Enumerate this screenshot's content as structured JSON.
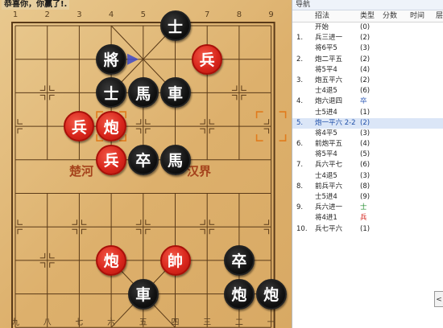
{
  "status_text": "恭喜你，你赢了!.",
  "board": {
    "top_files": [
      "1",
      "2",
      "3",
      "4",
      "5",
      "6",
      "7",
      "8",
      "9"
    ],
    "bottom_files": [
      "九",
      "八",
      "七",
      "六",
      "五",
      "四",
      "三",
      "二",
      "一"
    ],
    "river_left": "楚河",
    "river_right": "汉界",
    "pieces": [
      {
        "name": "black-advisor-top",
        "char": "士",
        "side": "black",
        "file": 5,
        "rank": 0
      },
      {
        "name": "black-general",
        "char": "將",
        "side": "black",
        "file": 3,
        "rank": 1
      },
      {
        "name": "red-soldier-upper-right",
        "char": "兵",
        "side": "red",
        "file": 6,
        "rank": 1
      },
      {
        "name": "black-advisor-mid",
        "char": "士",
        "side": "black",
        "file": 3,
        "rank": 2
      },
      {
        "name": "black-horse-top",
        "char": "馬",
        "side": "black",
        "file": 4,
        "rank": 2
      },
      {
        "name": "black-chariot-top",
        "char": "車",
        "side": "black",
        "file": 5,
        "rank": 2
      },
      {
        "name": "red-soldier-left",
        "char": "兵",
        "side": "red",
        "file": 2,
        "rank": 3
      },
      {
        "name": "red-cannon-top",
        "char": "炮",
        "side": "red",
        "file": 3,
        "rank": 3
      },
      {
        "name": "red-soldier-mid",
        "char": "兵",
        "side": "red",
        "file": 3,
        "rank": 4
      },
      {
        "name": "black-soldier-mid",
        "char": "卒",
        "side": "black",
        "file": 4,
        "rank": 4
      },
      {
        "name": "black-horse-mid",
        "char": "馬",
        "side": "black",
        "file": 5,
        "rank": 4
      },
      {
        "name": "red-cannon-bottom",
        "char": "炮",
        "side": "red",
        "file": 3,
        "rank": 7
      },
      {
        "name": "red-general",
        "char": "帥",
        "side": "red",
        "file": 5,
        "rank": 7
      },
      {
        "name": "black-soldier-bottom",
        "char": "卒",
        "side": "black",
        "file": 7,
        "rank": 7
      },
      {
        "name": "black-chariot-bottom",
        "char": "車",
        "side": "black",
        "file": 4,
        "rank": 8
      },
      {
        "name": "black-cannon-left",
        "char": "炮",
        "side": "black",
        "file": 7,
        "rank": 8
      },
      {
        "name": "black-cannon-right",
        "char": "炮",
        "side": "black",
        "file": 8,
        "rank": 8
      }
    ]
  },
  "panel": {
    "title": "导航",
    "headers": {
      "move": "招法",
      "type": "类型",
      "score": "分数",
      "time": "时间",
      "depth": "层"
    },
    "moves": [
      {
        "num": "",
        "move": "开始",
        "type": "(0)",
        "type_color": "normal",
        "selected": false
      },
      {
        "num": "1.",
        "move": "兵三进一",
        "type": "(2)",
        "type_color": "normal",
        "selected": false
      },
      {
        "num": "",
        "move": "将6平5",
        "type": "(3)",
        "type_color": "normal",
        "selected": false
      },
      {
        "num": "2.",
        "move": "炮二平五",
        "type": "(2)",
        "type_color": "normal",
        "selected": false
      },
      {
        "num": "",
        "move": "将5平4",
        "type": "(4)",
        "type_color": "normal",
        "selected": false
      },
      {
        "num": "3.",
        "move": "炮五平六",
        "type": "(2)",
        "type_color": "normal",
        "selected": false
      },
      {
        "num": "",
        "move": "士4退5",
        "type": "(6)",
        "type_color": "normal",
        "selected": false
      },
      {
        "num": "4.",
        "move": "炮六退四",
        "type": "卒",
        "type_color": "blue",
        "selected": false
      },
      {
        "num": "",
        "move": "士5进4",
        "type": "(1)",
        "type_color": "normal",
        "selected": false
      },
      {
        "num": "5.",
        "move": "炮一平六 2-2",
        "type": "(2)",
        "type_color": "normal",
        "selected": true
      },
      {
        "num": "",
        "move": "将4平5",
        "type": "(3)",
        "type_color": "normal",
        "selected": false
      },
      {
        "num": "6.",
        "move": "前炮平五",
        "type": "(4)",
        "type_color": "normal",
        "selected": false
      },
      {
        "num": "",
        "move": "将5平4",
        "type": "(5)",
        "type_color": "normal",
        "selected": false
      },
      {
        "num": "7.",
        "move": "兵六平七",
        "type": "(6)",
        "type_color": "normal",
        "selected": false
      },
      {
        "num": "",
        "move": "士4退5",
        "type": "(3)",
        "type_color": "normal",
        "selected": false
      },
      {
        "num": "8.",
        "move": "前兵平六",
        "type": "(8)",
        "type_color": "normal",
        "selected": false
      },
      {
        "num": "",
        "move": "士5进4",
        "type": "(9)",
        "type_color": "normal",
        "selected": false
      },
      {
        "num": "9.",
        "move": "兵六进一",
        "type": "士",
        "type_color": "green",
        "selected": false
      },
      {
        "num": "",
        "move": "将4进1",
        "type": "兵",
        "type_color": "red",
        "selected": false
      },
      {
        "num": "10.",
        "move": "兵七平六",
        "type": "(1)",
        "type_color": "normal",
        "selected": false
      }
    ],
    "scroll_label": "<"
  },
  "colors": {
    "red_piece": "#d9271d",
    "black_piece": "#111111",
    "board": "#ddb06c",
    "line": "#5a3a18",
    "selected_row": "#dbe6f7"
  }
}
